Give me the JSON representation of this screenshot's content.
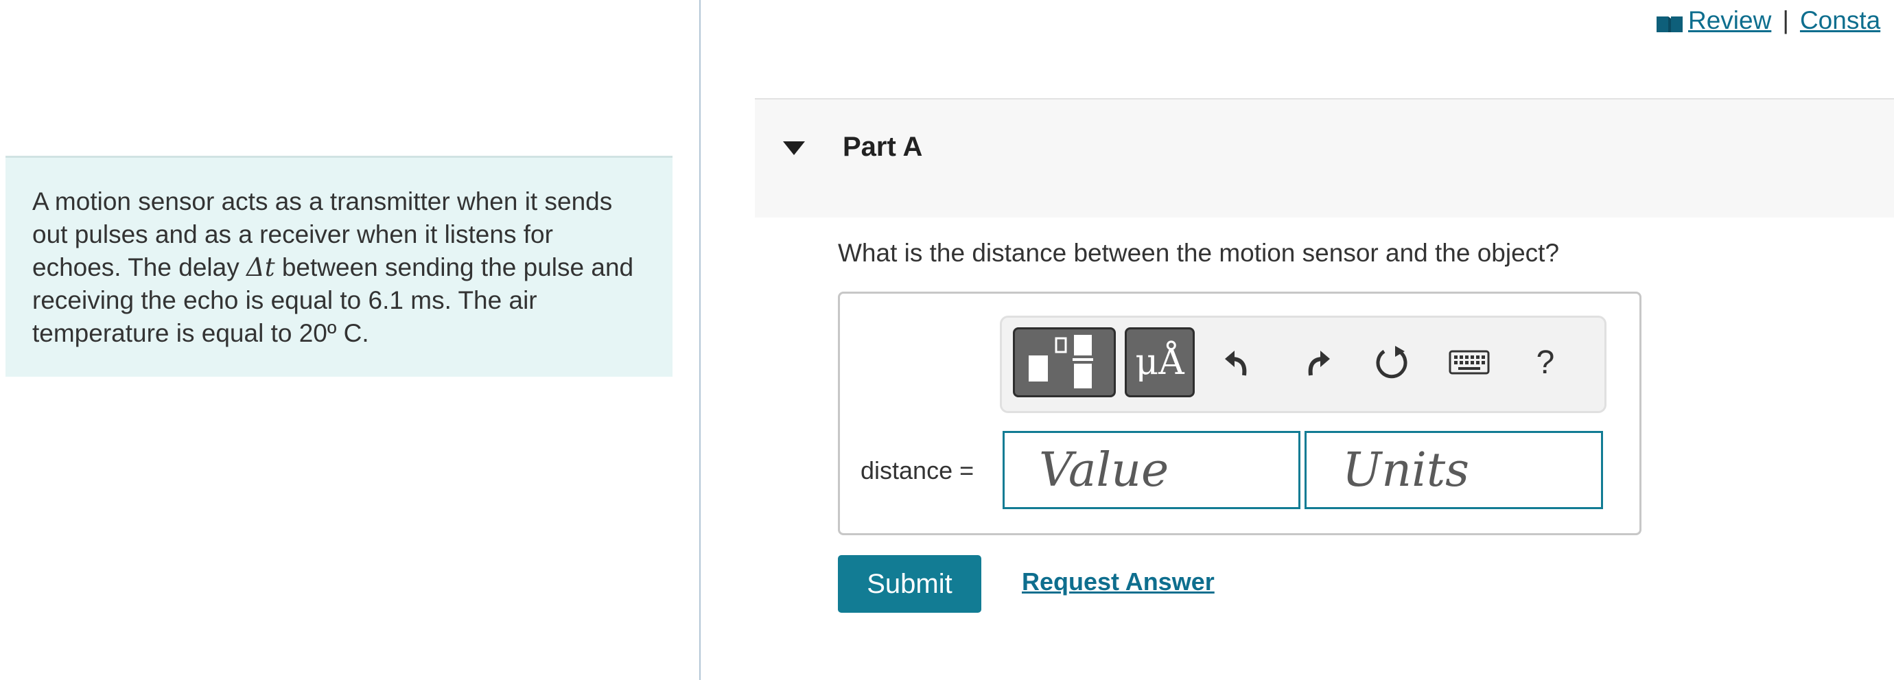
{
  "header": {
    "review_label": "Review",
    "separator": "|",
    "constants_label": "Consta"
  },
  "problem": {
    "text_1": "A motion sensor acts as a transmitter when it sends out pulses and as a receiver when it listens for echoes. The delay ",
    "math_symbol": "Δt",
    "text_2": " between sending the pulse and receiving the echo is equal to 6.1 ms. The air temperature is equal to 20º C."
  },
  "part": {
    "title": "Part A",
    "question": "What is the distance between the motion sensor and the object?"
  },
  "toolbar": {
    "units_label": "μÅ",
    "help_label": "?"
  },
  "answer": {
    "field_label": "distance =",
    "value_placeholder": "Value",
    "units_placeholder": "Units"
  },
  "actions": {
    "submit_label": "Submit",
    "request_label": "Request Answer"
  },
  "colors": {
    "accent": "#127c94",
    "link": "#0e6e8e",
    "problem_bg": "#e6f5f5"
  }
}
